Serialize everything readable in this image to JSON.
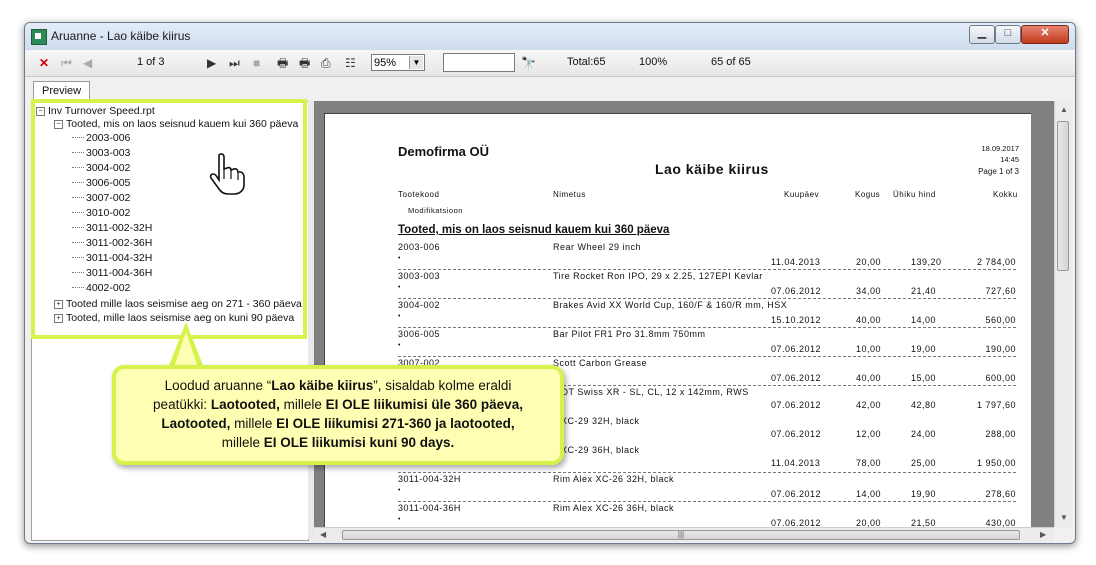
{
  "window": {
    "title": "Aruanne - Lao käibe kiirus"
  },
  "toolbar": {
    "page_counter": "1 of 3",
    "zoom_value": "95%",
    "search_value": "",
    "total_label": "Total:65",
    "percent_label": "100%",
    "records_label": "65 of 65"
  },
  "tabs": [
    {
      "label": "Preview"
    }
  ],
  "tree": {
    "root": "Inv Turnover Speed.rpt",
    "group1": "Tooted, mis on laos seisnud kauem kui 360 päeva",
    "items": [
      "2003-006",
      "3003-003",
      "3004-002",
      "3006-005",
      "3007-002",
      "3010-002",
      "3011-002-32H",
      "3011-002-36H",
      "3011-004-32H",
      "3011-004-36H",
      "4002-002"
    ],
    "group2": "Tooted mille laos seismise aeg on 271 - 360 päeva",
    "group3": "Tooted, mille laos seismise aeg on kuni 90 päeva"
  },
  "report": {
    "company": "Demofirma OÜ",
    "title": "Lao käibe kiirus",
    "date": "18.09.2017",
    "time": "14:45",
    "page": "Page 1 of 3",
    "columns": {
      "code": "Tootekood",
      "name": "Nimetus",
      "date": "Kuupäev",
      "qty": "Kogus",
      "unit_price": "Ühiku hind",
      "total": "Kokku",
      "modification": "Modifikatsioon"
    },
    "section_title": "Tooted, mis on laos seisnud kauem kui 360 päeva",
    "rows": [
      {
        "code": "2003-006",
        "name": "Rear Wheel 29 inch",
        "date": "11.04.2013",
        "qty": "20,00",
        "price": "139,20",
        "total": "2 784,00"
      },
      {
        "code": "3003-003",
        "name": "Tire Rocket Ron IPO, 29 x 2.25, 127EPI Kevlar",
        "date": "07.06.2012",
        "qty": "34,00",
        "price": "21,40",
        "total": "727,60"
      },
      {
        "code": "3004-002",
        "name": "Brakes Avid XX World Cup, 160/F & 160/R mm, HSX",
        "date": "15.10.2012",
        "qty": "40,00",
        "price": "14,00",
        "total": "560,00"
      },
      {
        "code": "3006-005",
        "name": "Bar Pilot FR1 Pro 31.8mm 750mm",
        "date": "07.06.2012",
        "qty": "10,00",
        "price": "19,00",
        "total": "190,00"
      },
      {
        "code": "3007-002",
        "name": "Scott Carbon Grease",
        "date": "07.06.2012",
        "qty": "40,00",
        "price": "15,00",
        "total": "600,00"
      },
      {
        "code": "",
        "name": "b DT Swiss XR - SL, CL, 12 x 142mm, RWS",
        "date": "07.06.2012",
        "qty": "42,00",
        "price": "42,80",
        "total": "1 797,60"
      },
      {
        "code": "",
        "name": "x XC-29 32H, black",
        "date": "07.06.2012",
        "qty": "12,00",
        "price": "24,00",
        "total": "288,00"
      },
      {
        "code": "",
        "name": "x XC-29 36H, black",
        "date": "11.04.2013",
        "qty": "78,00",
        "price": "25,00",
        "total": "1 950,00"
      },
      {
        "code": "3011-004-32H",
        "name": "Rim Alex XC-26 32H, black",
        "date": "07.06.2012",
        "qty": "14,00",
        "price": "19,90",
        "total": "278,60"
      },
      {
        "code": "3011-004-36H",
        "name": "Rim Alex XC-26 36H, black",
        "date": "07.06.2012",
        "qty": "20,00",
        "price": "21,50",
        "total": "430,00"
      }
    ]
  },
  "callout": {
    "t1": "Loodud aruanne “",
    "t2": "Lao käibe kiirus",
    "t3": "”, sisaldab kolme eraldi",
    "t4": "peatükki: ",
    "t5": "Laotooted,",
    "t6": " millele ",
    "t7": "EI OLE liikumisi üle 360 päeva,",
    "t8": "Laotooted,",
    "t9": " millele ",
    "t10": "EI OLE liikumisi 271-360 ja laotooted,",
    "t11": "millele ",
    "t12": "EI OLE liikumisi kuni 90 days."
  },
  "colors": {
    "highlight": "#d7f24a",
    "callout_bg": "#ffffb4",
    "close_red": "#c23b1e",
    "stop_red": "#cc0000"
  }
}
